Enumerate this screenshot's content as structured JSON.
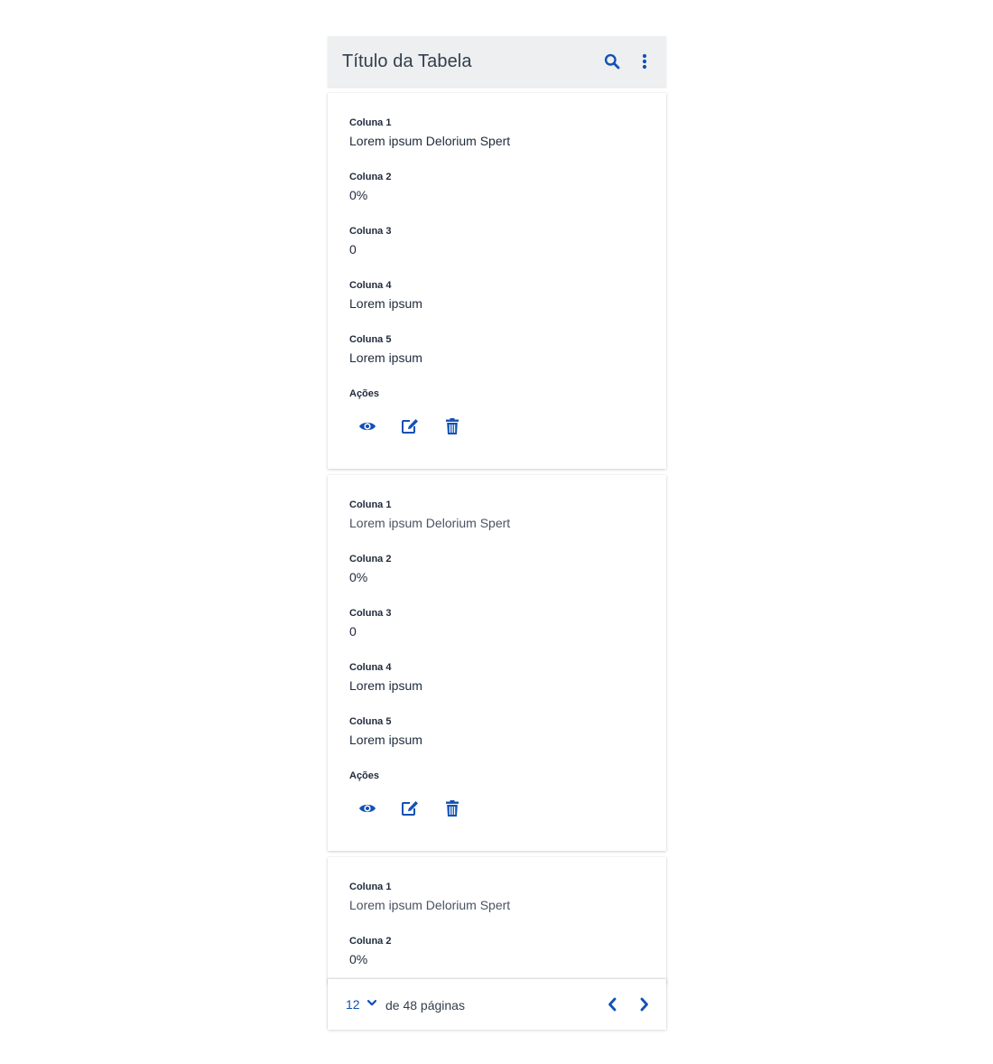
{
  "header": {
    "title": "Título da Tabela",
    "search_icon": "search-icon",
    "more_icon": "more-vertical-icon"
  },
  "colors": {
    "accent": "#1351b4",
    "header_bg": "#edeff0",
    "text": "#1e2a3b"
  },
  "cards": [
    {
      "fields": [
        {
          "label": "Coluna 1",
          "value": "Lorem ipsum Delorium Spert"
        },
        {
          "label": "Coluna 2",
          "value": "0%"
        },
        {
          "label": "Coluna 3",
          "value": "0"
        },
        {
          "label": "Coluna 4",
          "value": "Lorem ipsum"
        },
        {
          "label": "Coluna 5",
          "value": "Lorem ipsum"
        }
      ],
      "actions_label": "Ações",
      "actions": [
        "eye-icon",
        "edit-icon",
        "trash-icon"
      ]
    },
    {
      "fields": [
        {
          "label": "Coluna 1",
          "value": "Lorem ipsum Delorium Spert"
        },
        {
          "label": "Coluna 2",
          "value": "0%"
        },
        {
          "label": "Coluna 3",
          "value": "0"
        },
        {
          "label": "Coluna 4",
          "value": "Lorem ipsum"
        },
        {
          "label": "Coluna 5",
          "value": "Lorem ipsum"
        }
      ],
      "actions_label": "Ações",
      "actions": [
        "eye-icon",
        "edit-icon",
        "trash-icon"
      ]
    },
    {
      "fields": [
        {
          "label": "Coluna 1",
          "value": "Lorem ipsum Delorium Spert"
        },
        {
          "label": "Coluna 2",
          "value": "0%"
        }
      ]
    }
  ],
  "pagination": {
    "page_size": "12",
    "of_pages": "de 48 páginas",
    "prev_icon": "chevron-left-icon",
    "next_icon": "chevron-right-icon"
  }
}
